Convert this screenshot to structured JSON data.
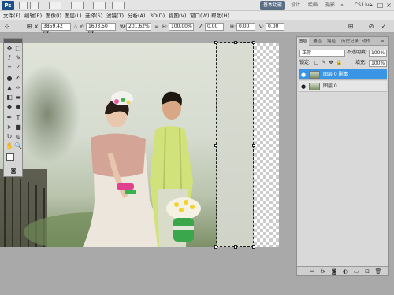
{
  "app": {
    "logo": "Ps",
    "cs_live": "CS Live"
  },
  "workspaces": [
    "基本功能",
    "设计",
    "绘画",
    "摄影"
  ],
  "menu": [
    "文件(F)",
    "编辑(E)",
    "图像(I)",
    "图层(L)",
    "选择(S)",
    "滤镜(T)",
    "分析(A)",
    "3D(D)",
    "视图(V)",
    "窗口(W)",
    "帮助(H)"
  ],
  "options": {
    "x_label": "X:",
    "x_value": "3859.42 px",
    "y_label": "Y:",
    "y_value": "1603.50 px",
    "w_label": "W:",
    "w_value": "201.62%",
    "h_label": "H:",
    "h_value": "100.00%",
    "angle_value": "0.00",
    "hskew_label": "H:",
    "hskew_value": "0.00",
    "vskew_label": "V:",
    "vskew_value": "0.00"
  },
  "layers_panel": {
    "tabs": [
      "图层",
      "通道",
      "路径",
      "历史记录",
      "动作"
    ],
    "blend_mode": "正常",
    "opacity_label": "不透明度:",
    "opacity_value": "100%",
    "lock_label": "锁定:",
    "fill_label": "填充:",
    "fill_value": "100%",
    "layers": [
      {
        "name": "图层 0 副本",
        "selected": true,
        "visible": true
      },
      {
        "name": "图层 0",
        "selected": false,
        "visible": true
      }
    ]
  },
  "colors": {
    "accent": "#3a96e5",
    "selected_layer": "#3a96e5",
    "workspace_active": "#5a6e84"
  }
}
